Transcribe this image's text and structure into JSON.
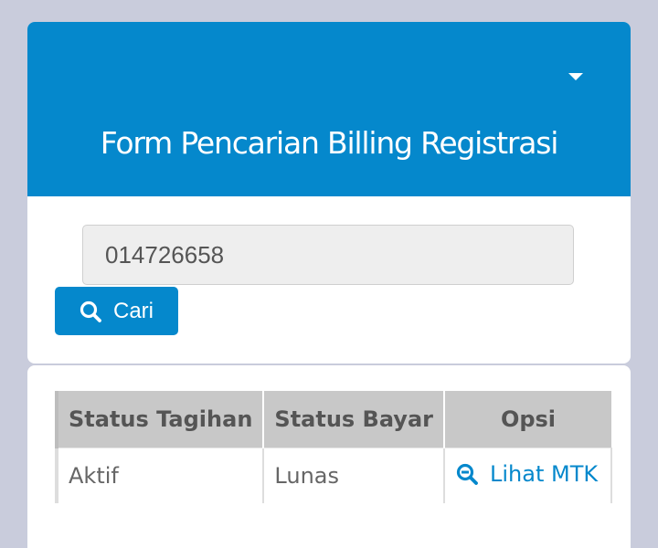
{
  "form": {
    "title": "Form Pencarian Billing Registrasi",
    "collapse_icon": "caret-down-icon",
    "search_value": "014726658",
    "search_button_label": "Cari",
    "search_button_icon": "magnifier-icon"
  },
  "table": {
    "headers": [
      "Status Tagihan",
      "Status Bayar",
      "Opsi"
    ],
    "rows": [
      {
        "status_tagihan": "Aktif",
        "status_bayar": "Lunas",
        "opsi_label": "Lihat MTK",
        "opsi_icon": "zoom-out-icon"
      }
    ]
  },
  "colors": {
    "primary": "#0588cc",
    "background": "#c9ccdc",
    "table_header_bg": "#c8c8c8"
  }
}
